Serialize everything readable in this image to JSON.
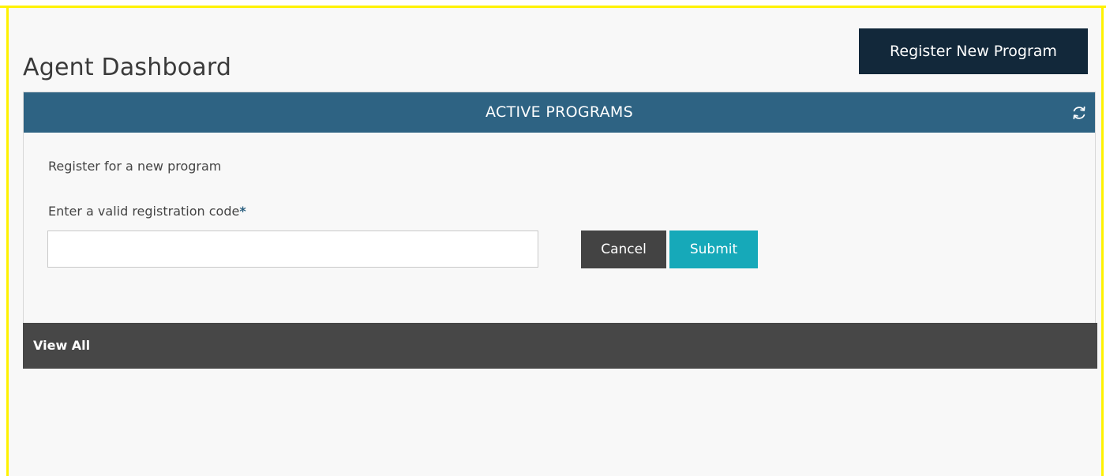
{
  "header": {
    "title": "Agent Dashboard",
    "register_button_label": "Register New Program"
  },
  "panel": {
    "title": "ACTIVE PROGRAMS",
    "refresh_icon": "refresh-icon",
    "section_label": "Register for a new program",
    "field_label": "Enter a valid registration code",
    "required_marker": "*",
    "code_input": {
      "value": "",
      "placeholder": ""
    },
    "cancel_label": "Cancel",
    "submit_label": "Submit",
    "footer_link": "View All"
  },
  "colors": {
    "frame": "#fff200",
    "header_bar": "#2e6383",
    "primary_button": "#12283a",
    "submit_button": "#16a9b9",
    "cancel_button": "#434343",
    "footer_bar": "#474747"
  }
}
